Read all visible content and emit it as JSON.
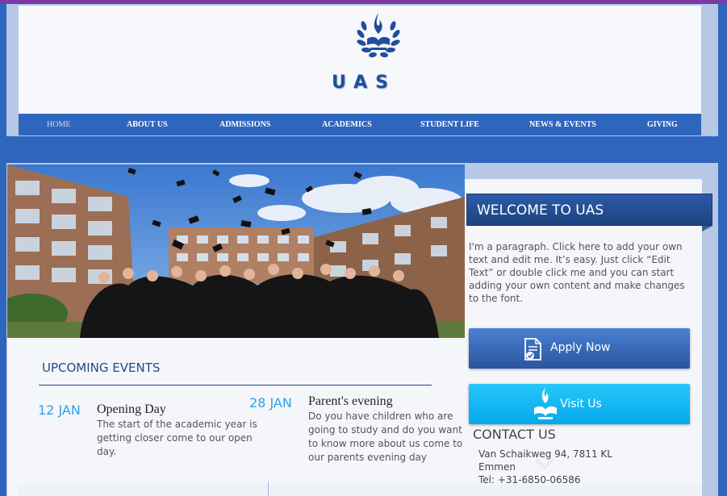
{
  "brand": {
    "name": "UAS",
    "logo_icon": "torch-book-laurel-icon"
  },
  "colors": {
    "primary": "#2f66bd",
    "navy": "#1f4a8a",
    "cyan": "#05a8ec",
    "accent_top": "#7b3aa6"
  },
  "nav": {
    "items": [
      {
        "label": "HOME",
        "active": true
      },
      {
        "label": "ABOUT US"
      },
      {
        "label": "ADMISSIONS"
      },
      {
        "label": "ACADEMICS"
      },
      {
        "label": "STUDENT LIFE"
      },
      {
        "label": "NEWS & EVENTS"
      },
      {
        "label": "GIVING"
      }
    ]
  },
  "hero": {
    "description_icon": "graduation-photo"
  },
  "welcome": {
    "title": "WELCOME TO UAS",
    "text": "I'm a paragraph. Click here to add your own text and edit me. It’s easy. Just click “Edit Text” or double click me and you can start adding your own content and make changes to the font."
  },
  "buttons": {
    "apply": {
      "label": "Apply Now",
      "icon": "document-check-icon"
    },
    "visit": {
      "label": "Visit Us",
      "icon": "torch-book-icon"
    }
  },
  "contact": {
    "title": "CONTACT US",
    "address_line1": "Van Schaikweg 94, 7811 KL",
    "address_line2": "Emmen",
    "phone": "Tel: +31-6850-06586"
  },
  "events": {
    "title": "UPCOMING EVENTS",
    "items": [
      {
        "date": "12 JAN",
        "title": "Opening Day",
        "desc_lines": [
          "The start of the academic year is",
          "getting closer come to our open",
          "day."
        ]
      },
      {
        "date": "28 JAN",
        "title": "Parent's evening",
        "desc_lines": [
          "Do you have children who are",
          "going to study and do you want",
          "to know more about us come to",
          "our parents evening day"
        ]
      }
    ]
  }
}
